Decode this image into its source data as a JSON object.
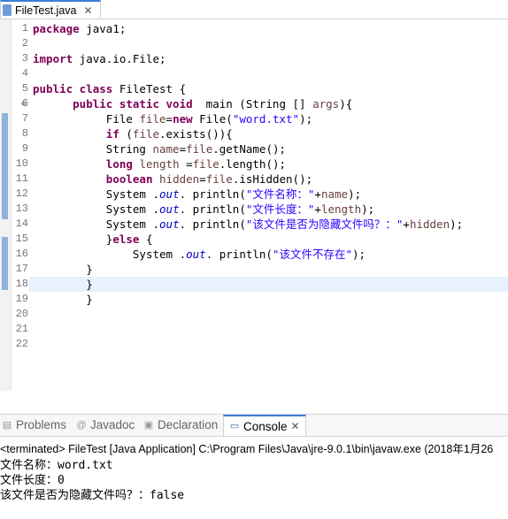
{
  "editor": {
    "tab_label": "FileTest.java",
    "line_numbers": [
      "1",
      "2",
      "3",
      "4",
      "5",
      "6",
      "7",
      "8",
      "9",
      "10",
      "11",
      "12",
      "13",
      "14",
      "15",
      "16",
      "17",
      "18",
      "19",
      "20",
      "21",
      "22"
    ]
  },
  "code": {
    "l1_kw": "package",
    "l1_rest": " java1;",
    "l3_kw": "import",
    "l3_rest": " java.io.File;",
    "l5_kw": "public class",
    "l5_rest": " FileTest {",
    "l6_kw": "public static void",
    "l6_rest": "  main (String [] ",
    "l6_var": "args",
    "l6_end": "){",
    "l7_a": "File ",
    "l7_var": "file",
    "l7_b": "=",
    "l7_kw": "new",
    "l7_c": " File(",
    "l7_str": "\"word.txt\"",
    "l7_d": ");",
    "l8_kw": "if",
    "l8_a": " (",
    "l8_var": "file",
    "l8_b": ".exists()){",
    "l9_a": "String ",
    "l9_var": "name",
    "l9_b": "=",
    "l9_var2": "file",
    "l9_c": ".getName();",
    "l10_kw": "long",
    "l10_a": " ",
    "l10_var": "length",
    "l10_b": " =",
    "l10_var2": "file",
    "l10_c": ".length();",
    "l11_kw": "boolean",
    "l11_a": " ",
    "l11_var": "hidden",
    "l11_b": "=",
    "l11_var2": "file",
    "l11_c": ".isHidden();",
    "l12_a": "System .",
    "l12_out": "out",
    "l12_b": ". println(",
    "l12_str": "\"文件名称：\"",
    "l12_c": "+",
    "l12_var": "name",
    "l12_d": ");",
    "l13_a": "System .",
    "l13_out": "out",
    "l13_b": ". println(",
    "l13_str": "\"文件长度：\"",
    "l13_c": "+",
    "l13_var": "length",
    "l13_d": ");",
    "l14_a": "System .",
    "l14_out": "out",
    "l14_b": ". println(",
    "l14_str": "\"该文件是否为隐藏文件吗？：\"",
    "l14_c": "+",
    "l14_var": "hidden",
    "l14_d": ");",
    "l15_a": "}",
    "l15_kw": "else",
    "l15_b": " {",
    "l16_a": "System .",
    "l16_out": "out",
    "l16_b": ". println(",
    "l16_str": "\"该文件不存在\"",
    "l16_c": ");",
    "l17": "}",
    "l18": "}",
    "l19": "}"
  },
  "views": {
    "problems": "Problems",
    "javadoc": "Javadoc",
    "declaration": "Declaration",
    "console": "Console"
  },
  "console": {
    "terminated": "<terminated> FileTest [Java Application] C:\\Program Files\\Java\\jre-9.0.1\\bin\\javaw.exe (2018年1月26",
    "output": [
      "文件名称：word.txt",
      "文件长度：0",
      "该文件是否为隐藏文件吗？：false"
    ]
  },
  "colors": {
    "keyword": "#7f0055",
    "string": "#2a00ff",
    "field": "#0000c0",
    "variable": "#6a3e3e",
    "active_tab": "#3b7fd6"
  },
  "icons": {
    "java_file": "java-file-icon",
    "console": "console-icon",
    "problems": "problems-icon",
    "javadoc": "javadoc-icon",
    "declaration": "declaration-icon"
  }
}
